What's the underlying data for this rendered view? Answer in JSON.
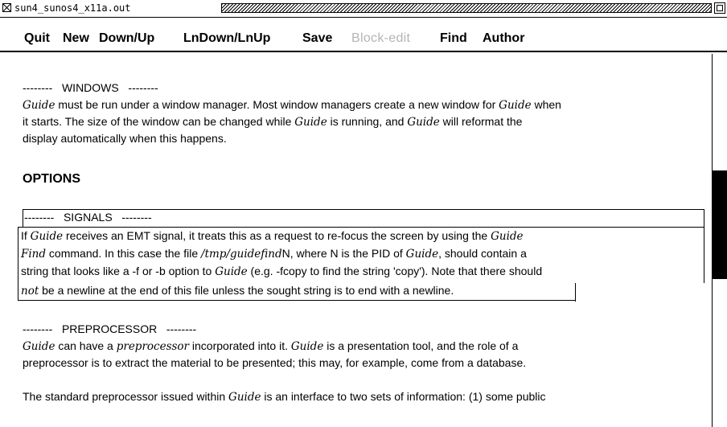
{
  "window": {
    "title": "sun4_sunos4_x11a.out"
  },
  "menu": {
    "items": [
      {
        "label": "Quit",
        "enabled": true
      },
      {
        "label": "New",
        "enabled": true
      },
      {
        "label": "Down/Up",
        "enabled": true
      },
      {
        "label": "LnDown/LnUp",
        "enabled": true
      },
      {
        "label": "Save",
        "enabled": true
      },
      {
        "label": "Block-edit",
        "enabled": false
      },
      {
        "label": "Find",
        "enabled": true
      },
      {
        "label": "Author",
        "enabled": true
      }
    ]
  },
  "content": {
    "windows": {
      "heading": "--------   WINDOWS   --------",
      "lines": [
        [
          "Guide",
          " must be run under a window manager.  Most window managers create a new window for ",
          "Guide",
          " when"
        ],
        [
          "it starts.  The size of the window can be changed while ",
          "Guide",
          " is running, and ",
          "Guide",
          " will reformat the"
        ],
        [
          "display automatically when this happens."
        ]
      ]
    },
    "options_title": "OPTIONS",
    "signals": {
      "heading": "--------   SIGNALS   --------",
      "line1_a": "If ",
      "line1_b": "Guide",
      "line1_c": " receives an EMT signal, it treats this as a request to re-focus the screen by using the ",
      "line1_d": "Guide",
      "line2_a": "Find",
      "line2_b": " command.  In this case the file ",
      "line2_c": "/tmp/guidefind",
      "line2_d": "N, where N is the PID of ",
      "line2_e": "Guide",
      "line2_f": ", should contain a",
      "line3_a": "string that looks like a -f or -b option to ",
      "line3_b": "Guide",
      "line3_c": " (e.g. -fcopy to find the string 'copy').  Note that there should",
      "line4_a": "not",
      "line4_b": " be a newline at the end of this file unless the sought string is to end with a newline."
    },
    "preprocessor": {
      "heading": "--------   PREPROCESSOR   --------",
      "line1_a": "Guide",
      "line1_b": " can have a ",
      "line1_c": "preprocessor",
      "line1_d": " incorporated into it.  ",
      "line1_e": "Guide",
      "line1_f": " is a presentation tool, and the role of a",
      "line2": "preprocessor is to extract the material to be presented; this may, for example, come from a database.",
      "line3_a": "The standard preprocessor issued within ",
      "line3_b": "Guide",
      "line3_c": " is an interface to two sets of information: (1) some public"
    }
  },
  "scrollbar": {
    "thumb_color": "#000000"
  }
}
